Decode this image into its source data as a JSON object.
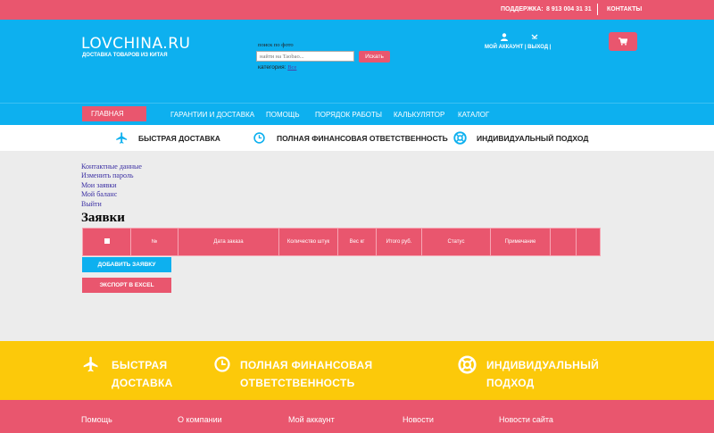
{
  "topbar": {
    "support_label": "ПОДДЕРЖКА:",
    "phone": "8 913 004 31 31",
    "contacts_label": "КОНТАКТЫ"
  },
  "header": {
    "logo": "LOVCHINA.RU",
    "logo_sub": "ДОСТАВКА ТОВАРОВ ИЗ КИТАЯ",
    "search_label": "поиск по фото",
    "search_placeholder": "найти на Taobao...",
    "search_button": "Искать",
    "category_label": "категория:",
    "category_value": "Все",
    "account_label": "МОЙ АККАУНТ",
    "exit_label": "ВЫХОД"
  },
  "nav": {
    "home": "ГЛАВНАЯ",
    "items": [
      "ГАРАНТИИ И ДОСТАВКА",
      "ПОМОЩЬ",
      "ПОРЯДОК РАБОТЫ",
      "КАЛЬКУЛЯТОР",
      "КАТАЛОГ"
    ]
  },
  "features": [
    "БЫСТРАЯ ДОСТАВКА",
    "ПОЛНАЯ ФИНАНСОВАЯ ОТВЕТСТВЕННОСТЬ",
    "ИНДИВИДУАЛЬНЫЙ ПОДХОД"
  ],
  "account_links": [
    "Контактные данные",
    "Изменить пароль",
    "Мои заявки",
    "Мой баланс",
    "Выйти"
  ],
  "page_title": "Заявки",
  "table": {
    "headers": [
      "№",
      "Дата заказа",
      "Количество штук",
      "Вес кг",
      "Итого руб.",
      "Статус",
      "Примечание",
      "",
      ""
    ]
  },
  "buttons": {
    "add": "ДОБАВИТЬ ЗАЯВКУ",
    "export": "ЭКСПОРТ В EXCEL"
  },
  "yellow_features": [
    {
      "line1": "БЫСТРАЯ",
      "line2": "ДОСТАВКА"
    },
    {
      "line1": "ПОЛНАЯ ФИНАНСОВАЯ",
      "line2": "ОТВЕТСТВЕННОСТЬ"
    },
    {
      "line1": "ИНДИВИДУАЛЬНЫЙ",
      "line2": "ПОДХОД"
    }
  ],
  "footer": [
    "Помощь",
    "О компании",
    "Мой аккаунт",
    "Новости",
    "Новости сайта"
  ],
  "colors": {
    "pink": "#e9566e",
    "blue": "#0db0ef",
    "yellow": "#fcc90a"
  }
}
